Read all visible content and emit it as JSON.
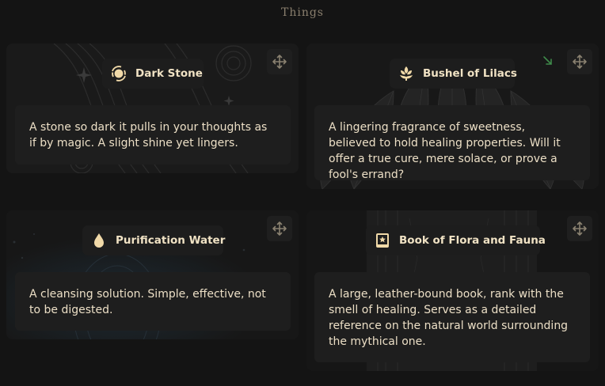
{
  "page": {
    "title": "Things"
  },
  "items": [
    {
      "name": "Dark Stone",
      "icon": "orbit-stone-icon",
      "description": "A stone so dark it pulls in your thoughts as if by magic. A slight shine yet lingers."
    },
    {
      "name": "Bushel of Lilacs",
      "icon": "flower-bushel-icon",
      "description": "A lingering fragrance of sweetness, believed to hold healing properties. Will it offer a true cure, mere solace, or prove a fool's errand?"
    },
    {
      "name": "Purification Water",
      "icon": "water-drop-icon",
      "description": "A cleansing solution. Simple, effective, not to be digested."
    },
    {
      "name": "Book of Flora and Fauna",
      "icon": "book-icon",
      "description": "A large, leather-bound book, rank with the smell of healing. Serves as a detailed reference on the natural world surrounding the mythical one."
    }
  ],
  "colors": {
    "background": "#141414",
    "card": "#1a1a1a",
    "accent": "#f0d9a8",
    "resize_accent": "#3f8a4a"
  },
  "icons": {
    "move": "move-arrows-icon",
    "resize": "resize-corner-icon"
  }
}
